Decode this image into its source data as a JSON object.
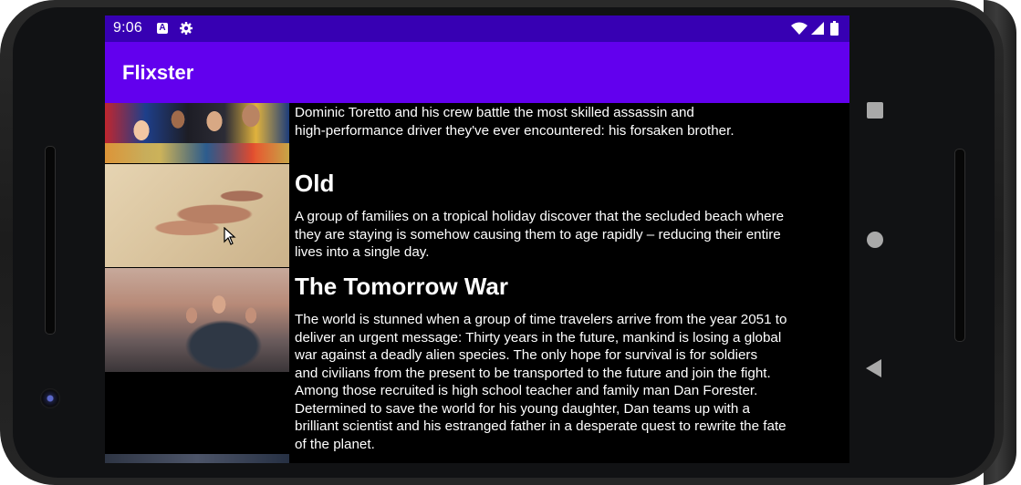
{
  "status_bar": {
    "time": "9:06",
    "left_icons": [
      "a-icon",
      "gear-icon"
    ],
    "right_icons": [
      "wifi-icon",
      "signal-icon",
      "battery-icon"
    ],
    "color": "#3700b3"
  },
  "app_bar": {
    "title": "Flixster",
    "color": "#6200ee"
  },
  "movies": [
    {
      "title": "",
      "overview_lines": [
        "Dominic Toretto and his crew battle the most skilled assassin and",
        "high-performance driver they've ever encountered: his forsaken brother."
      ]
    },
    {
      "title": "Old",
      "overview_lines": [
        "A group of families on a tropical holiday discover that the secluded beach where",
        "they are staying is somehow causing them to age rapidly – reducing their entire",
        "lives into a single day."
      ]
    },
    {
      "title": "The Tomorrow War",
      "overview_lines": [
        "The world is stunned when a group of time travelers arrive from the year 2051 to",
        "deliver an urgent message: Thirty years in the future, mankind is losing a global",
        "war against a deadly alien species. The only hope for survival is for soldiers",
        "and civilians from the present to be transported to the future and join the fight.",
        "Among those recruited is high school teacher and family man Dan Forester.",
        "Determined to save the world for his young daughter, Dan teams up with a",
        "brilliant scientist and his estranged father in a desperate quest to rewrite the fate",
        "of the planet."
      ]
    }
  ],
  "nav_buttons": [
    "recents-square-icon",
    "home-circle-icon",
    "back-triangle-icon"
  ]
}
